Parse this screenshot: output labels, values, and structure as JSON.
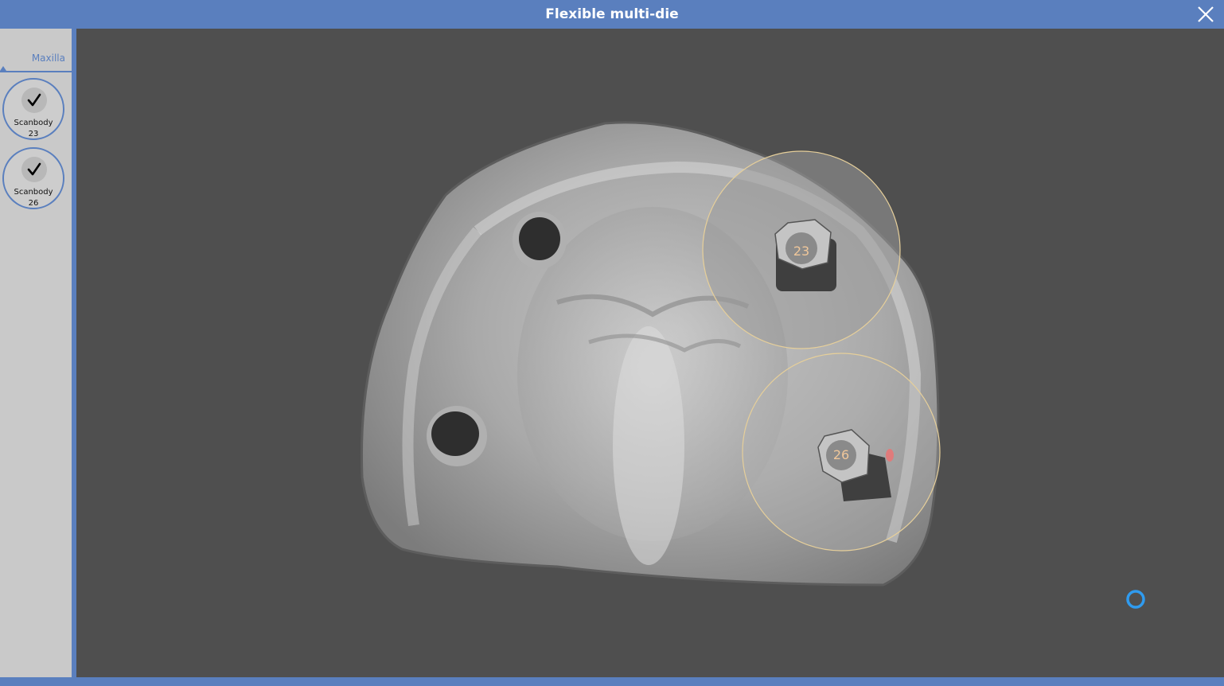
{
  "window": {
    "title": "Flexible multi-die"
  },
  "sidebar": {
    "tab_label": "Maxilla",
    "scanbodies": [
      {
        "label": "Scanbody",
        "number": "23"
      },
      {
        "label": "Scanbody",
        "number": "26"
      }
    ]
  },
  "viewport": {
    "markers": [
      {
        "number": "23"
      },
      {
        "number": "26"
      }
    ]
  },
  "colors": {
    "accent": "#5a7fbe",
    "background": "#4f4f4f",
    "sidebar": "#c9c9c9",
    "marker_ring": "#e6cf9a",
    "marker_text": "#f0c79a",
    "spinner": "#2f9bef"
  },
  "icons": {
    "close": "close-icon",
    "check": "checkmark-icon",
    "spinner": "loading-spinner-icon"
  }
}
